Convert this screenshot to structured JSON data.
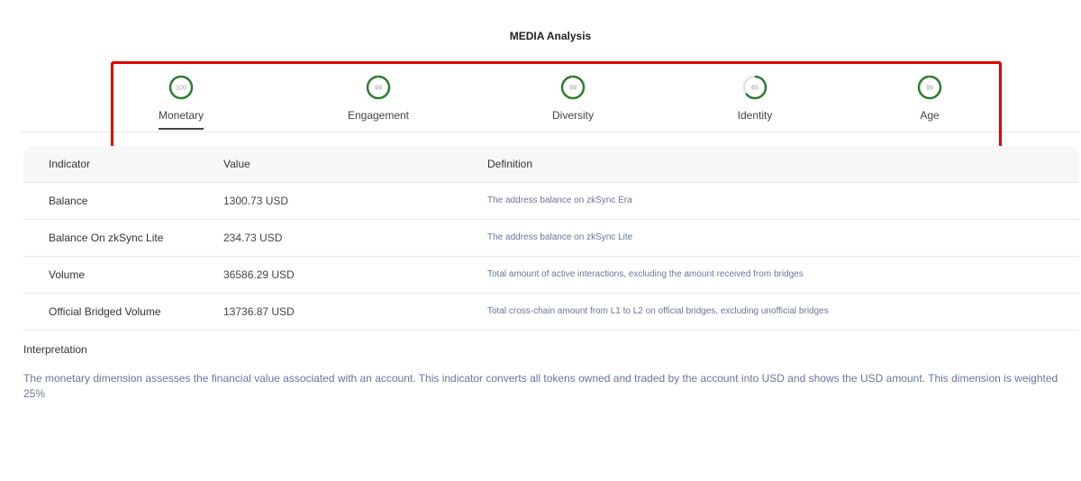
{
  "title": "MEDIA Analysis",
  "tabs": [
    {
      "label": "Monetary",
      "score": "100",
      "level": 1.0,
      "active": true
    },
    {
      "label": "Engagement",
      "score": "99",
      "level": 0.99,
      "active": false
    },
    {
      "label": "Diversity",
      "score": "99",
      "level": 0.99,
      "active": false
    },
    {
      "label": "Identity",
      "score": "65",
      "level": 0.65,
      "active": false
    },
    {
      "label": "Age",
      "score": "99",
      "level": 0.99,
      "active": false
    }
  ],
  "colors": {
    "ring": "#2e7d32",
    "track": "#e3e3e3",
    "highlight": "#e00000",
    "definition_text": "#6a7599"
  },
  "table": {
    "headers": [
      "Indicator",
      "Value",
      "Definition"
    ],
    "rows": [
      {
        "indicator": "Balance",
        "value": "1300.73 USD",
        "definition": "The address balance on zkSync Era"
      },
      {
        "indicator": "Balance On zkSync Lite",
        "value": "234.73 USD",
        "definition": "The address balance on zkSync Lite"
      },
      {
        "indicator": "Volume",
        "value": "36586.29 USD",
        "definition": "Total amount of active interactions, excluding the amount received from bridges"
      },
      {
        "indicator": "Official Bridged Volume",
        "value": "13736.87 USD",
        "definition": "Total cross-chain amount from L1 to L2 on official bridges, excluding unofficial bridges"
      }
    ]
  },
  "interpretation": {
    "title": "Interpretation",
    "text": "The monetary dimension assesses the financial value associated with an account. This indicator converts all tokens owned and traded by the account into USD and shows the USD amount. This dimension is weighted 25%"
  }
}
